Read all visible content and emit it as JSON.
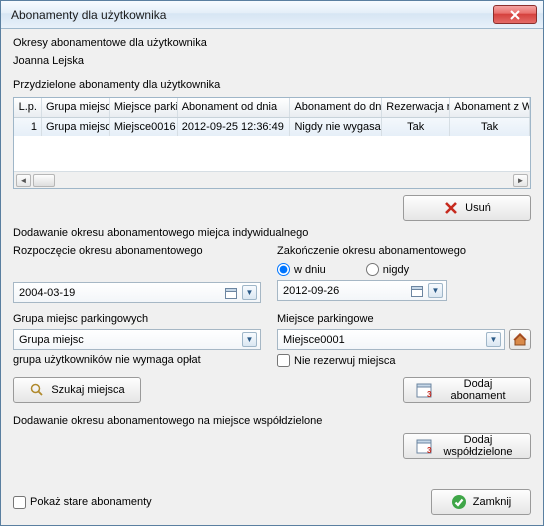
{
  "window": {
    "title": "Abonamenty dla użytkownika"
  },
  "header": {
    "line1": "Okresy abonamentowe dla użytkownika",
    "line2": "Joanna Lejska"
  },
  "assigned": {
    "title": "Przydzielone abonamenty dla użytkownika",
    "columns": {
      "lp": "L.p.",
      "grupa_miejsc": "Grupa miejsc",
      "miejsce_parkingowe": "Miejsce parki",
      "abon_od": "Abonament od dnia",
      "abon_do": "Abonament do dn",
      "rezerwacja": "Rezerwacja r",
      "abon_z": "Abonament z",
      "wsp": "Wsp"
    },
    "rows": [
      {
        "lp": "1",
        "grupa_miejsc": "Grupa miejsc",
        "miejsce_parkingowe": "Miejsce0016",
        "abon_od": "2012-09-25 12:36:49",
        "abon_do": "Nigdy nie wygasa",
        "rezerwacja": "Tak",
        "abon_z": "Tak"
      }
    ],
    "delete_label": "Usuń"
  },
  "add_individual": {
    "title": "Dodawanie okresu abonamentowego miejca indywidualnego",
    "start_label": "Rozpoczęcie okresu abonamentowego",
    "end_label": "Zakończenie okresu abonamentowego",
    "radio_on_day": "w dniu",
    "radio_never": "nigdy",
    "start_date": "2004-03-19",
    "end_date": "2012-09-26",
    "group_label": "Grupa miejsc parkingowych",
    "group_value": "Grupa miejsc",
    "place_label": "Miejsce parkingowe",
    "place_value": "Miejsce0001",
    "no_fee_note": "grupa użytkowników nie wymaga opłat",
    "no_reserve_label": "Nie rezerwuj miejsca",
    "search_label": "Szukaj miejsca",
    "add_label": "Dodaj abonament"
  },
  "add_shared": {
    "title": "Dodawanie okresu abonamentowego na miejsce współdzielone",
    "add_label": "Dodaj współdzielone"
  },
  "footer": {
    "show_old_label": "Pokaż stare abonamenty",
    "close_label": "Zamknij"
  }
}
